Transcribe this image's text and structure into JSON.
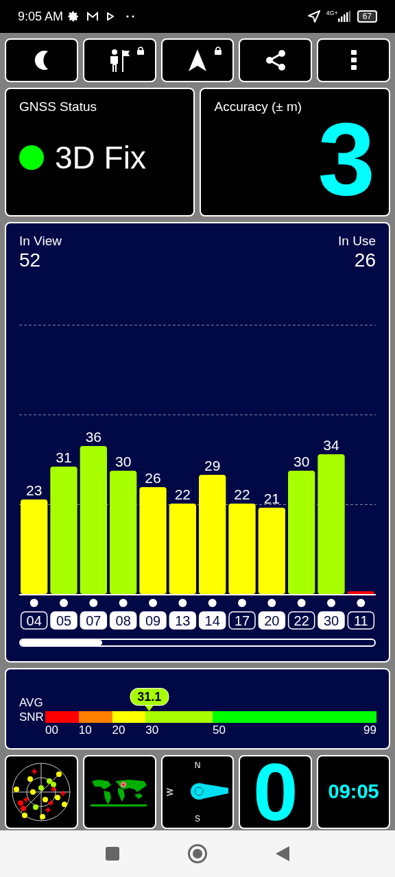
{
  "status_bar": {
    "time": "9:05 AM",
    "network": "4G+",
    "battery": "67"
  },
  "toolbar": [
    {
      "kind": "night",
      "locked": false
    },
    {
      "kind": "waypoint",
      "locked": true
    },
    {
      "kind": "navigate",
      "locked": true
    },
    {
      "kind": "share",
      "locked": false
    },
    {
      "kind": "menu",
      "locked": false
    }
  ],
  "gnss_status": {
    "title": "GNSS Status",
    "value": "3D Fix",
    "color": "#00ff00"
  },
  "accuracy": {
    "title": "Accuracy (± m)",
    "value": "3"
  },
  "satellites": {
    "in_view_label": "In View",
    "in_view": "52",
    "in_use_label": "In Use",
    "in_use": "26",
    "used": [
      false,
      true,
      true,
      true,
      true,
      true,
      true,
      false,
      true,
      false,
      true,
      false
    ],
    "chart_data": {
      "type": "bar",
      "categories": [
        "04",
        "05",
        "07",
        "08",
        "09",
        "13",
        "14",
        "17",
        "20",
        "22",
        "30",
        "11"
      ],
      "values": [
        23,
        31,
        36,
        30,
        26,
        22,
        29,
        22,
        21,
        30,
        34,
        0
      ],
      "value_labels": [
        "23",
        "31",
        "36",
        "30",
        "26",
        "22",
        "29",
        "22",
        "21",
        "30",
        "34",
        null
      ]
    }
  },
  "snr": {
    "label_top": "AVG",
    "label_bottom": "SNR",
    "reading": "31.1",
    "ticks": [
      "00",
      "10",
      "20",
      "30",
      "50",
      "99"
    ]
  },
  "tiles": {
    "compass": [
      "N",
      "W",
      "S"
    ],
    "speed": "0",
    "clock": "09:05"
  }
}
